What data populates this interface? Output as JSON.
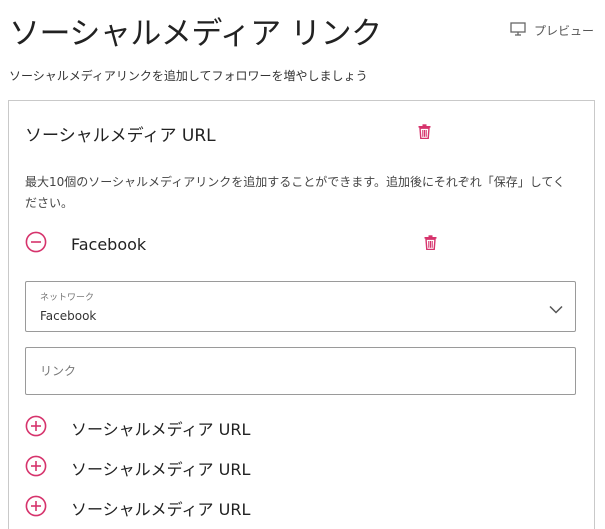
{
  "page": {
    "title": "ソーシャルメディア リンク",
    "preview_label": "プレビュー",
    "subtitle": "ソーシャルメディアリンクを追加してフォロワーを増やしましょう"
  },
  "panel": {
    "section_title": "ソーシャルメディア URL",
    "description": "最大10個のソーシャルメディアリンクを追加することができます。追加後にそれぞれ「保存」してください。",
    "expanded_item": {
      "label": "Facebook",
      "network_field": {
        "label": "ネットワーク",
        "value": "Facebook"
      },
      "link_field": {
        "placeholder": "リンク",
        "value": ""
      }
    },
    "collapsed_items": [
      {
        "label": "ソーシャルメディア URL"
      },
      {
        "label": "ソーシャルメディア URL"
      },
      {
        "label": "ソーシャルメディア URL"
      }
    ]
  },
  "colors": {
    "accent": "#d6336c",
    "border": "#9a9a9a",
    "text": "#222222"
  },
  "icons": {
    "preview": "monitor-icon",
    "delete": "trash-icon",
    "collapse": "minus-circle-icon",
    "expand": "plus-circle-icon",
    "dropdown": "chevron-down-icon"
  }
}
